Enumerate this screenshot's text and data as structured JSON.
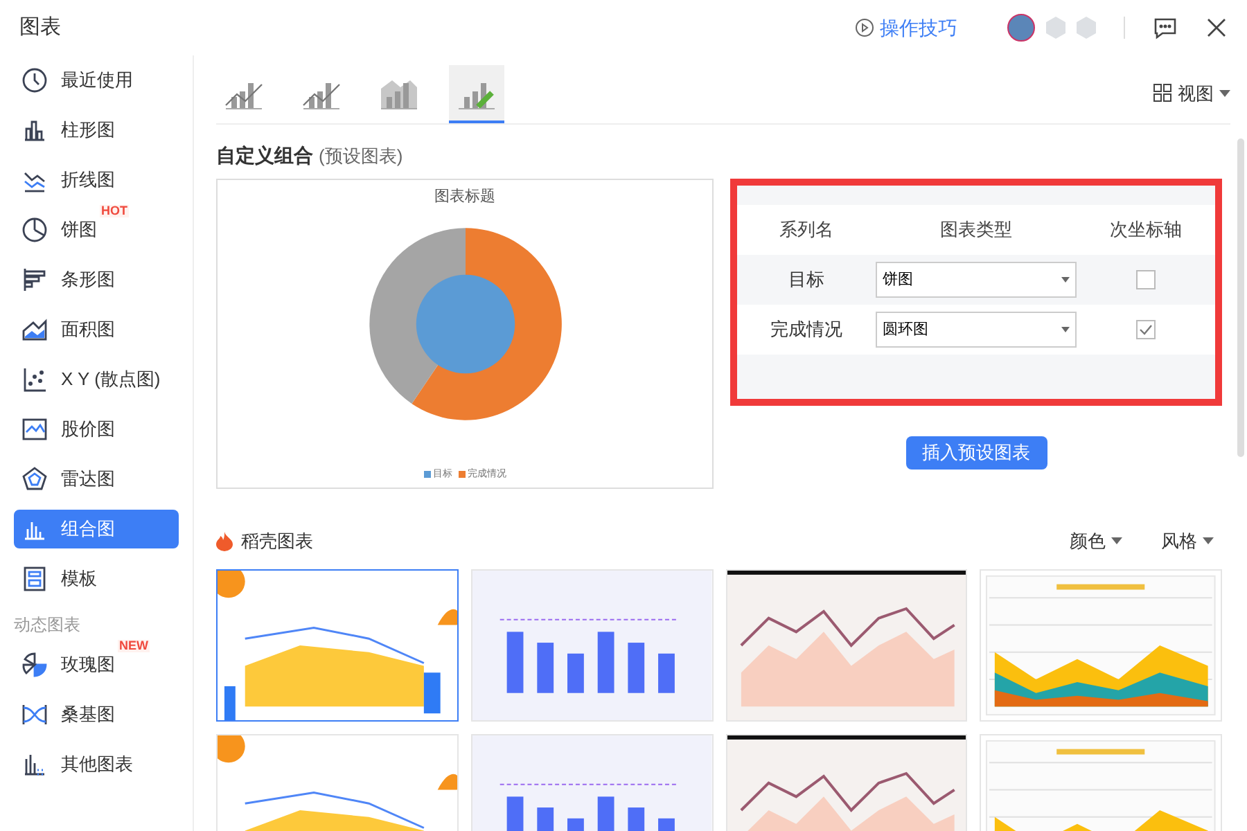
{
  "window": {
    "title": "图表"
  },
  "header": {
    "tips_link": "操作技巧"
  },
  "sidebar": {
    "groups": [
      {
        "items": [
          {
            "label": "最近使用",
            "selected": false
          },
          {
            "label": "柱形图",
            "selected": false
          },
          {
            "label": "折线图",
            "selected": false
          },
          {
            "label": "饼图",
            "selected": false,
            "badge": "HOT"
          },
          {
            "label": "条形图",
            "selected": false
          },
          {
            "label": "面积图",
            "selected": false
          },
          {
            "label": "X Y (散点图)",
            "selected": false
          },
          {
            "label": "股价图",
            "selected": false
          },
          {
            "label": "雷达图",
            "selected": false
          },
          {
            "label": "组合图",
            "selected": true
          },
          {
            "label": "模板",
            "selected": false
          }
        ]
      },
      {
        "heading": "动态图表",
        "items": [
          {
            "label": "玫瑰图",
            "selected": false,
            "badge": "NEW"
          },
          {
            "label": "桑基图",
            "selected": false
          },
          {
            "label": "其他图表",
            "selected": false
          }
        ]
      }
    ]
  },
  "tabs": [
    {
      "selected": false
    },
    {
      "selected": false
    },
    {
      "selected": false
    },
    {
      "selected": true
    }
  ],
  "view_button": "视图",
  "section": {
    "title": "自定义组合",
    "subtitle": "(预设图表)"
  },
  "preview": {
    "title": "图表标题",
    "legend": [
      {
        "label": "目标",
        "color": "#5b9bd5"
      },
      {
        "label": "完成情况",
        "color": "#ed7d31"
      }
    ]
  },
  "series_table": {
    "columns": [
      "系列名",
      "图表类型",
      "次坐标轴"
    ],
    "rows": [
      {
        "name": "目标",
        "type": "饼图",
        "secondary_axis": false
      },
      {
        "name": "完成情况",
        "type": "圆环图",
        "secondary_axis": true
      }
    ]
  },
  "insert_button": "插入预设图表",
  "templates_section": {
    "title": "稻壳图表",
    "filters": [
      "颜色",
      "风格"
    ]
  }
}
